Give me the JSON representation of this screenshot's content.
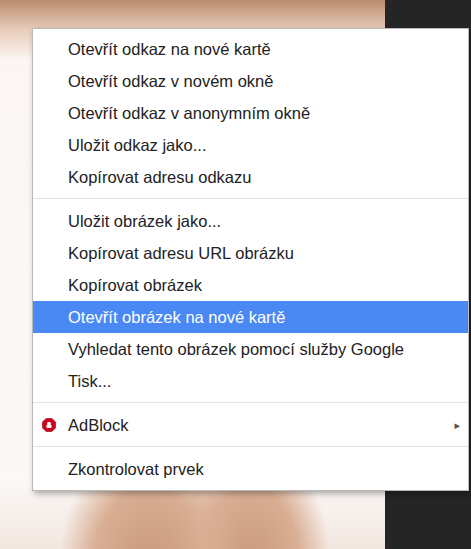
{
  "menu": {
    "groups": [
      {
        "items": [
          {
            "kind": "item",
            "label": "Otevřít odkaz na nové kartě",
            "selected": false
          },
          {
            "kind": "item",
            "label": "Otevřít odkaz v novém okně",
            "selected": false
          },
          {
            "kind": "item",
            "label": "Otevřít odkaz v anonymním okně",
            "selected": false
          },
          {
            "kind": "item",
            "label": "Uložit odkaz jako...",
            "selected": false
          },
          {
            "kind": "item",
            "label": "Kopírovat adresu odkazu",
            "selected": false
          }
        ]
      },
      {
        "items": [
          {
            "kind": "item",
            "label": "Uložit obrázek jako...",
            "selected": false
          },
          {
            "kind": "item",
            "label": "Kopírovat adresu URL obrázku",
            "selected": false
          },
          {
            "kind": "item",
            "label": "Kopírovat obrázek",
            "selected": false
          },
          {
            "kind": "item",
            "label": "Otevřít obrázek na nové kartě",
            "selected": true
          },
          {
            "kind": "item",
            "label": "Vyhledat tento obrázek pomocí služby Google",
            "selected": false
          },
          {
            "kind": "item",
            "label": "Tisk...",
            "selected": false
          }
        ]
      },
      {
        "items": [
          {
            "kind": "submenu",
            "label": "AdBlock",
            "arrow": "▸",
            "selected": false
          }
        ]
      },
      {
        "items": [
          {
            "kind": "item",
            "label": "Zkontrolovat prvek",
            "selected": false
          }
        ]
      }
    ]
  }
}
